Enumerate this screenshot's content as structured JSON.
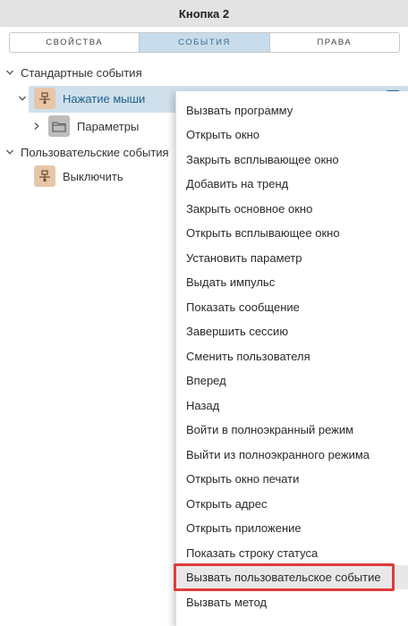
{
  "window": {
    "title": "Кнопка 2"
  },
  "tabs": [
    {
      "label": "СВОЙСТВА"
    },
    {
      "label": "СОБЫТИЯ"
    },
    {
      "label": "ПРАВА"
    }
  ],
  "tree": {
    "standard_group": "Стандартные события",
    "mouse_click": "Нажатие мыши",
    "parameters": "Параметры",
    "custom_group": "Пользовательские события",
    "turn_off": "Выключить"
  },
  "context_menu": {
    "items": [
      "Вызвать программу",
      "Открыть окно",
      "Закрыть всплывающее окно",
      "Добавить на тренд",
      "Закрыть основное окно",
      "Открыть всплывающее окно",
      "Установить параметр",
      "Выдать импульс",
      "Показать сообщение",
      "Завершить сессию",
      "Сменить пользователя",
      "Вперед",
      "Назад",
      "Войти в полноэкранный режим",
      "Выйти из полноэкранного режима",
      "Открыть окно печати",
      "Открыть адрес",
      "Открыть приложение",
      "Показать строку статуса",
      "Вызвать пользовательское событие",
      "Вызвать метод"
    ]
  },
  "colors": {
    "accent": "#c8dceb",
    "selected_text": "#1f5e8c",
    "highlight_border": "#e03b3b"
  }
}
